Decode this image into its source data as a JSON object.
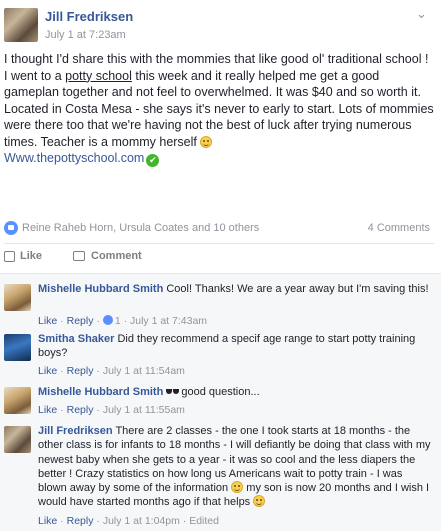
{
  "post": {
    "author": "Jill Fredriksen",
    "timestamp": "July 1 at 7:23am",
    "menu_icon": "chevron-down-icon",
    "text_line1": "I thought I'd share this with the mommies that like good ol' traditional school !",
    "text_line2_before": "I went to a ",
    "text_line2_link": "potty school",
    "text_line2_after": " this week and it really helped me get a good gameplan together and not feel to overwhelmed. It was $40 and so worth it.",
    "text_line3": "Located in Costa Mesa - she says it's never to early to start. Lots of mommies were there too that we're having not the best of luck after trying numerous times. Teacher is a mommy herself ",
    "link": "Www.thepottyschool.com",
    "reactors": "Reine Raheb Horn, Ursula Coates and 10 others",
    "comments_count": "4 Comments",
    "like_label": "Like",
    "comment_label": "Comment",
    "accent_color": "#365899"
  },
  "comments": [
    {
      "author": "Mishelle Hubbard Smith",
      "text": "Cool! Thanks! We are a year away but I'm saving this!",
      "like": "Like",
      "reply": "Reply",
      "likes": "1",
      "time": "July 1 at 7:43am"
    },
    {
      "author": "Smitha Shaker",
      "text": "Did they recommend a specif age range to start potty training boys?",
      "like": "Like",
      "reply": "Reply",
      "time": "July 1 at 11:54am"
    },
    {
      "author": "Mishelle Hubbard Smith",
      "text": "good question...",
      "like": "Like",
      "reply": "Reply",
      "time": "July 1 at 11:55am"
    },
    {
      "author": "Jill Fredriksen",
      "text_a": "There are 2 classes - the one I took starts at 18 months - the other class is for infants to 18 months - I will defiantly be doing that class with my newest baby when she gets to a year - it was so cool and the less diapers the better ! Crazy statistics on how long us Americans wait to potty train - I was blown away by some of the information ",
      "text_b": " my son is now 20 months and I wish I would have started months ago if that helps ",
      "like": "Like",
      "reply": "Reply",
      "time": "July 1 at 1:04pm",
      "edited": "Edited"
    }
  ],
  "separator": " · "
}
